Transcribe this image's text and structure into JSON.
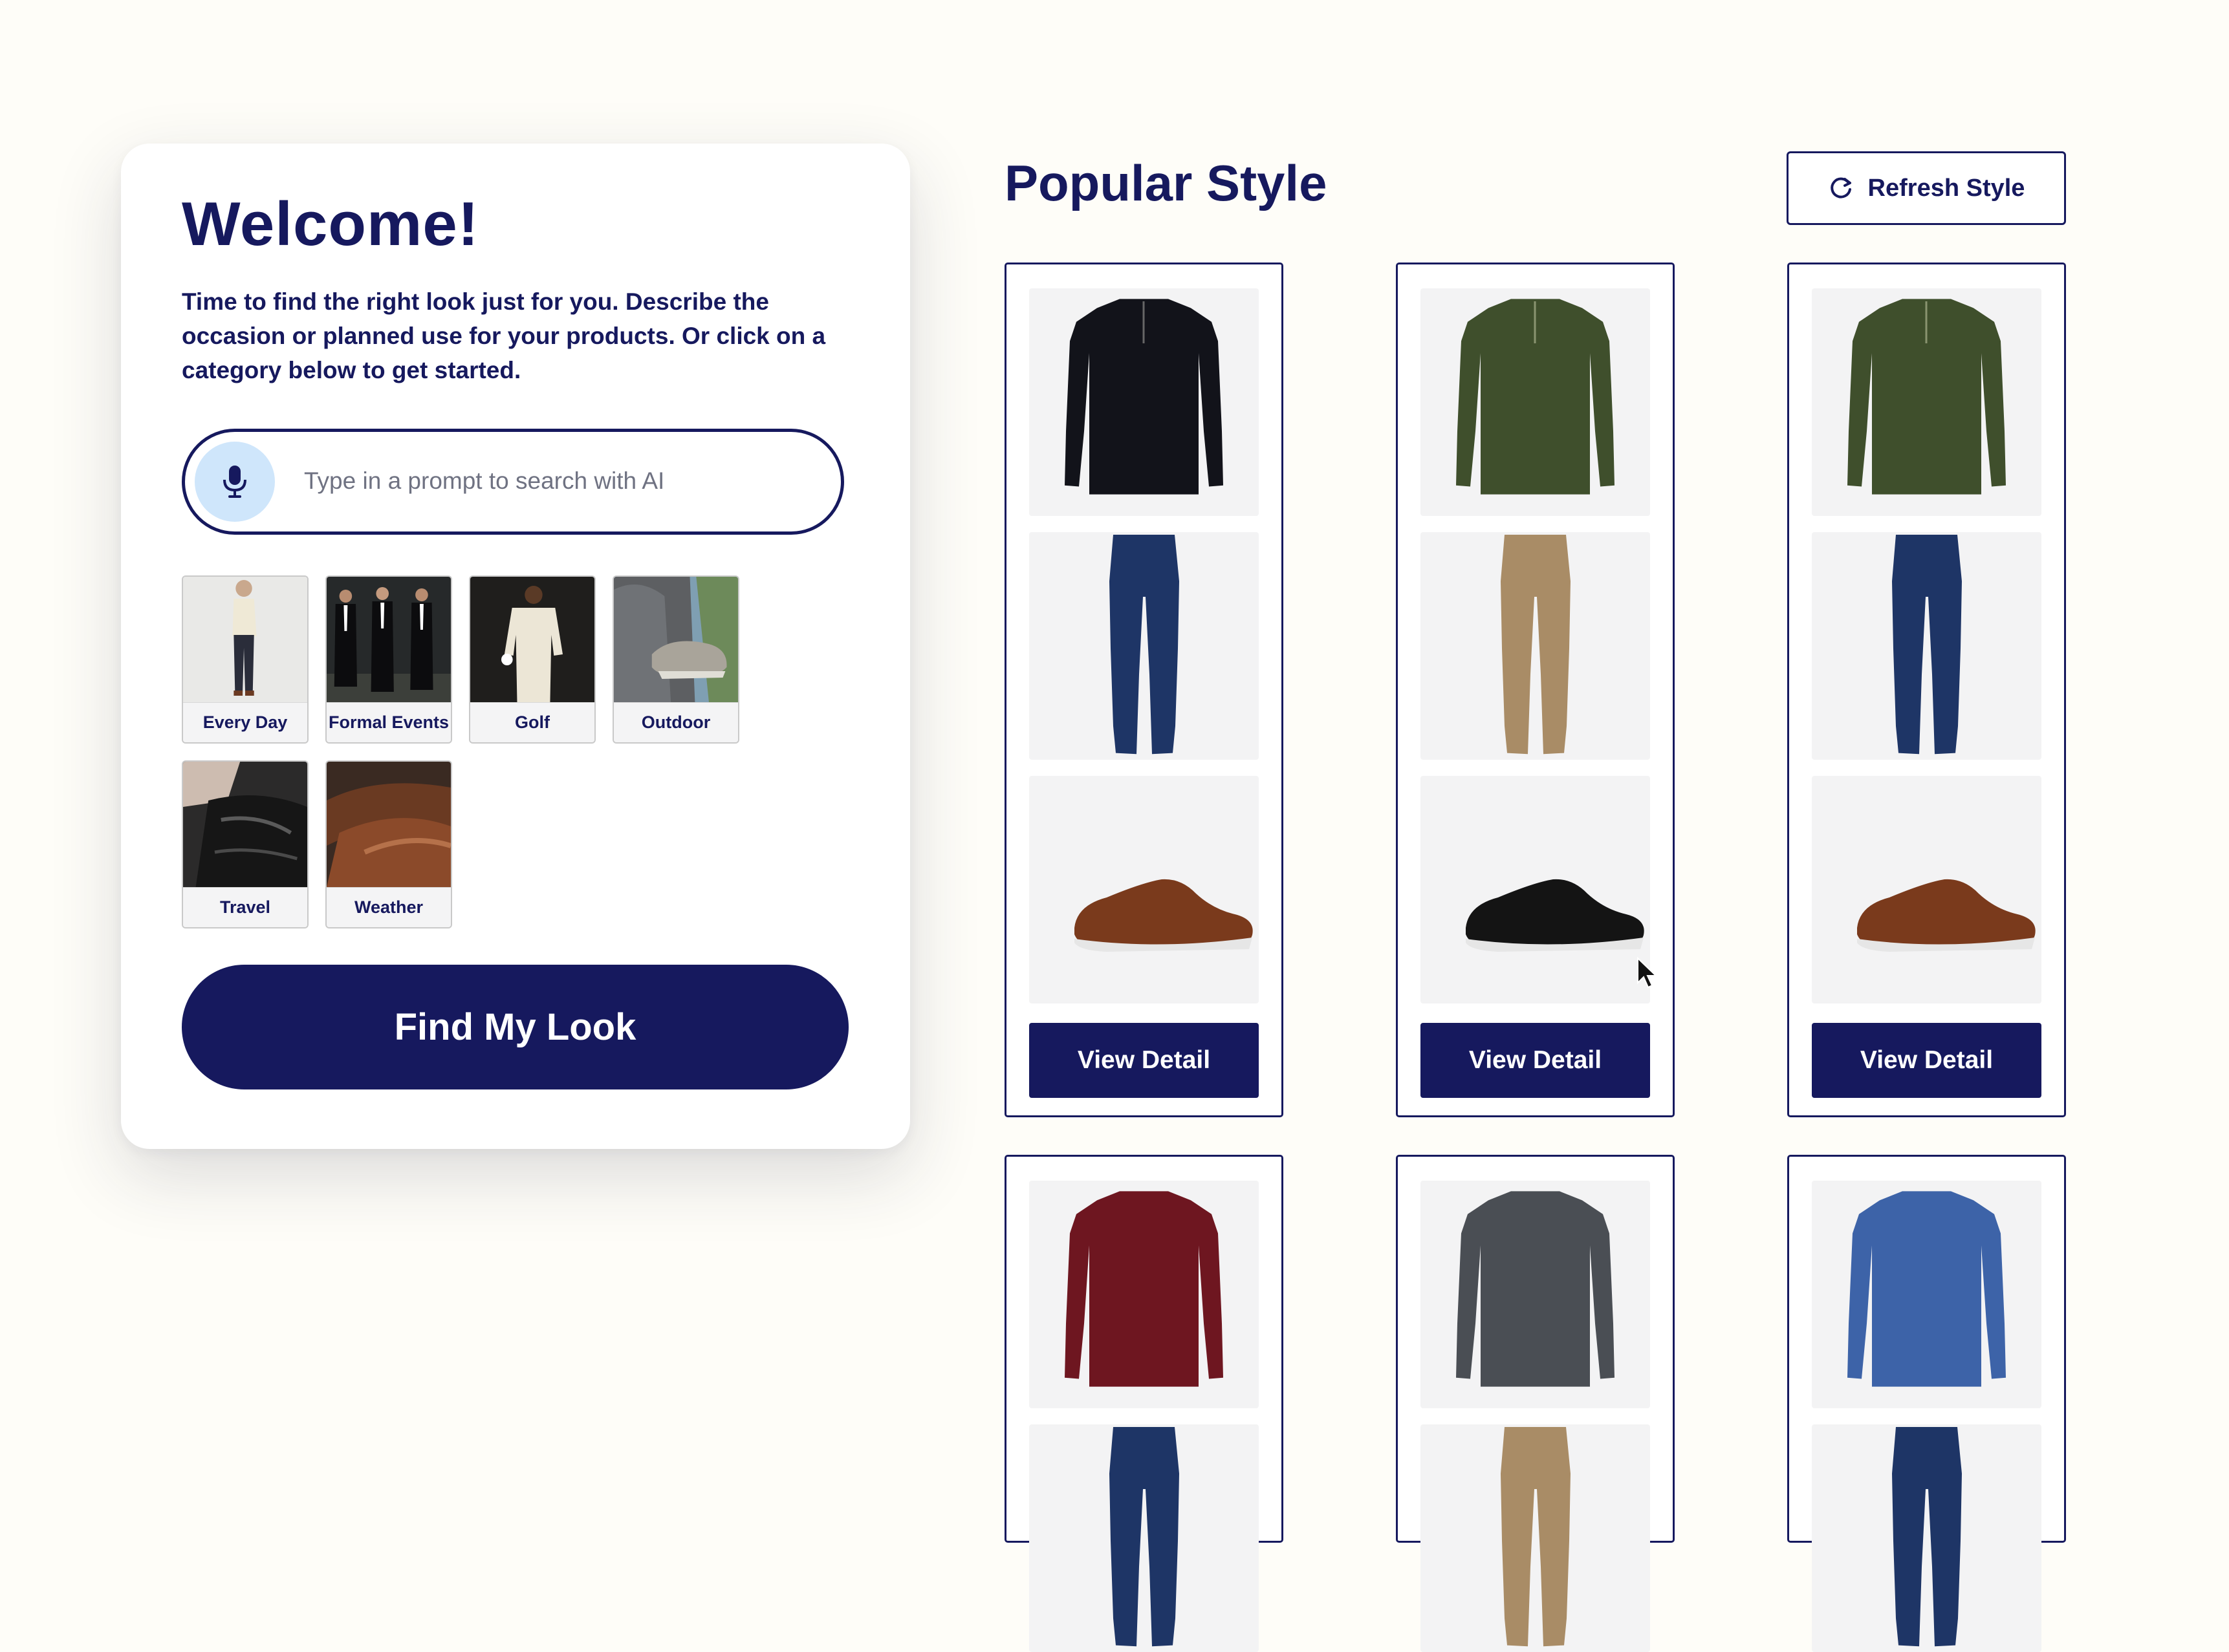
{
  "welcome": {
    "title": "Welcome!",
    "description": "Time to find the right look just for you.  Describe the occasion or planned use for your products. Or click on a category below to get started.",
    "search_placeholder": "Type in a prompt to search with AI",
    "mic_icon": "microphone-icon",
    "categories": [
      {
        "label": "Every Day"
      },
      {
        "label": "Formal Events"
      },
      {
        "label": "Golf"
      },
      {
        "label": "Outdoor"
      },
      {
        "label": "Travel"
      },
      {
        "label": "Weather"
      }
    ],
    "find_button": "Find My Look"
  },
  "popular": {
    "title": "Popular Style",
    "refresh_button": "Refresh Style",
    "refresh_icon": "refresh-icon",
    "outfits": [
      {
        "top": "black quarter-zip sweater",
        "bottom": "dark blue jeans",
        "shoes": "brown leather oxford",
        "view_button": "View Detail"
      },
      {
        "top": "olive quarter-zip sweater",
        "bottom": "khaki chinos",
        "shoes": "black leather oxford",
        "view_button": "View Detail"
      },
      {
        "top": "olive quarter-zip sweater",
        "bottom": "dark blue jeans",
        "shoes": "brown leather oxford",
        "view_button": "View Detail"
      },
      {
        "top": "burgundy polo sweater",
        "bottom": "dark blue jeans"
      },
      {
        "top": "charcoal polo sweater",
        "bottom": "khaki chinos"
      },
      {
        "top": "blue quarter-zip sweater",
        "bottom": "dark blue jeans"
      }
    ]
  },
  "colors": {
    "accent": "#16195e",
    "background": "#fefdf8",
    "mic_bg": "#cfe6fb",
    "tile_bg": "#f4f4f5"
  }
}
